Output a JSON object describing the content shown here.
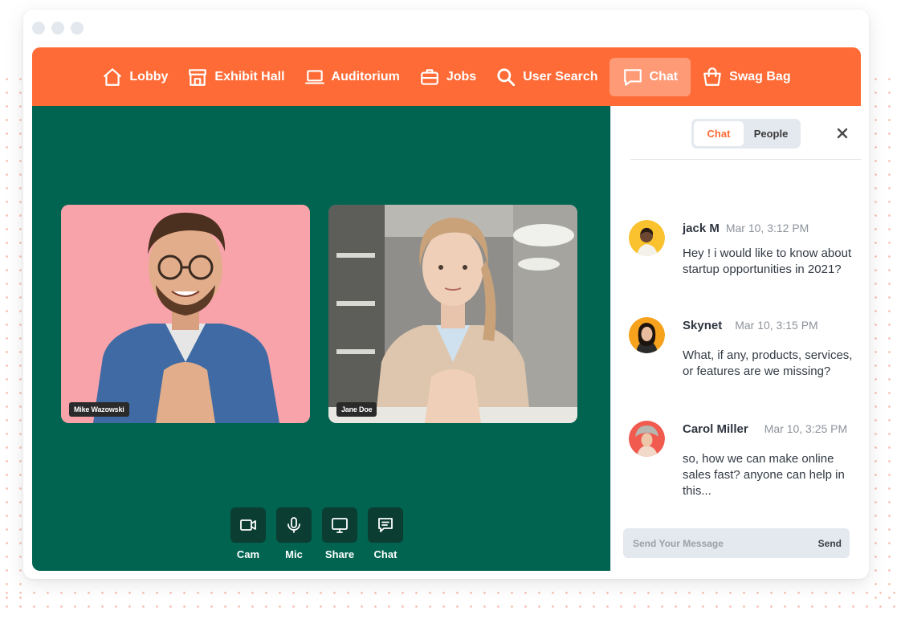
{
  "nav": {
    "items": [
      {
        "label": "Lobby",
        "icon": "home-icon"
      },
      {
        "label": "Exhibit Hall",
        "icon": "store-icon"
      },
      {
        "label": "Auditorium",
        "icon": "laptop-icon"
      },
      {
        "label": "Jobs",
        "icon": "briefcase-icon"
      },
      {
        "label": "User Search",
        "icon": "search-icon"
      },
      {
        "label": "Chat",
        "icon": "chat-icon",
        "active": true
      },
      {
        "label": "Swag Bag",
        "icon": "bag-icon"
      }
    ],
    "color": "#fe6b36"
  },
  "stage": {
    "background": "#006450",
    "participants": [
      {
        "name": "Mike Wazowski"
      },
      {
        "name": "Jane Doe"
      }
    ],
    "controls": [
      {
        "label": "Cam",
        "icon": "camera-icon"
      },
      {
        "label": "Mic",
        "icon": "mic-icon"
      },
      {
        "label": "Share",
        "icon": "monitor-icon"
      },
      {
        "label": "Chat",
        "icon": "message-icon"
      }
    ]
  },
  "panel": {
    "tabs": {
      "chat": "Chat",
      "people": "People"
    },
    "messages": [
      {
        "name": "jack M",
        "time": "Mar 10, 3:12 PM",
        "text": "Hey ! i would like to  know about startup opportunities in 2021?"
      },
      {
        "name": "Skynet",
        "time": "Mar 10, 3:15 PM",
        "text": "What, if any, products, services, or features are we missing?"
      },
      {
        "name": "Carol Miller",
        "time": "Mar 10, 3:25 PM",
        "text": "so, how we can make online sales fast? anyone can help in this..."
      }
    ],
    "composer": {
      "placeholder": "Send Your Message",
      "send_label": "Send"
    }
  }
}
